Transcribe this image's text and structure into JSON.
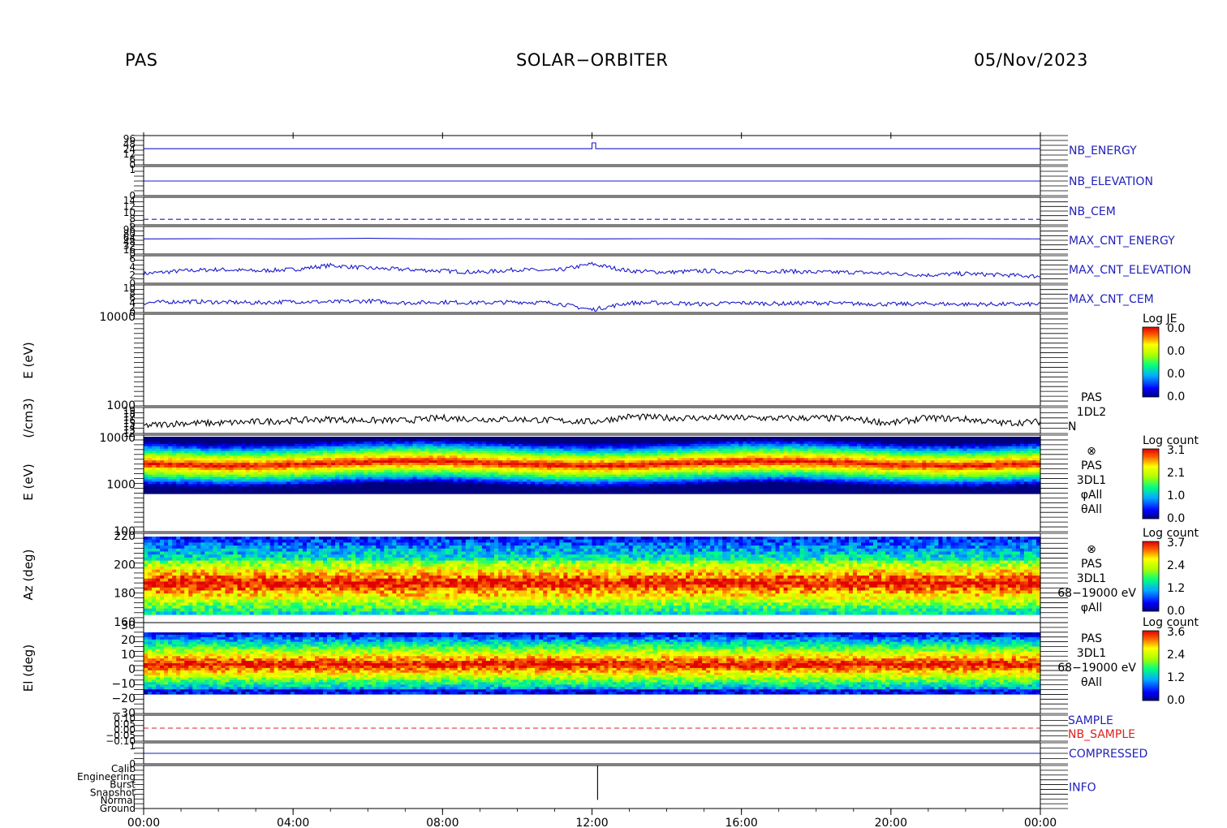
{
  "header": {
    "instrument": "PAS",
    "mission": "SOLAR−ORBITER",
    "date": "05/Nov/2023"
  },
  "colors": {
    "line_blue": "#1a1acc",
    "label_blue": "#2222bb",
    "label_red": "#dd2222",
    "black": "#000000"
  },
  "chart_data": [
    {
      "type": "line",
      "panel": "nb_energy",
      "title": "NB_ENERGY",
      "title_color": "#2222bb",
      "yticks": [
        "96",
        "48",
        "24",
        "12",
        "6",
        "0"
      ],
      "x_hours": [
        0,
        12,
        12,
        12.1,
        12.1,
        24
      ],
      "values": [
        0.55,
        0.55,
        0.75,
        0.75,
        0.55,
        0.55
      ],
      "ylim": [
        0,
        1
      ]
    },
    {
      "type": "line",
      "panel": "nb_elevation",
      "title": "NB_ELEVATION",
      "title_color": "#2222bb",
      "yticks": [
        "1",
        "",
        "",
        "",
        "",
        "0"
      ],
      "x_hours": [
        0,
        24
      ],
      "values": [
        0.5,
        0.5
      ],
      "ylim": [
        0,
        1
      ]
    },
    {
      "type": "line",
      "panel": "nb_cem",
      "title": "NB_CEM",
      "title_color": "#2222bb",
      "yticks": [
        "14",
        "12",
        "10",
        "8",
        "6"
      ],
      "x_hours": [
        0,
        24
      ],
      "values": [
        0.2,
        0.2
      ],
      "ylim": [
        0,
        1
      ],
      "dashed": true
    },
    {
      "type": "line",
      "panel": "max_cnt_energy",
      "title": "MAX_CNT_ENERGY",
      "title_color": "#2222bb",
      "yticks": [
        "96",
        "80",
        "64",
        "48",
        "32",
        "16",
        "0"
      ],
      "x_hours": [
        0,
        2,
        4,
        6,
        8,
        10,
        12,
        14,
        16,
        18,
        20,
        22,
        24
      ],
      "values": [
        0.55,
        0.56,
        0.55,
        0.57,
        0.55,
        0.56,
        0.55,
        0.56,
        0.55,
        0.56,
        0.55,
        0.56,
        0.55
      ],
      "ylim": [
        0,
        1
      ]
    },
    {
      "type": "line",
      "panel": "max_cnt_elevation",
      "title": "MAX_CNT_ELEVATION",
      "title_color": "#2222bb",
      "yticks": [
        "6",
        "4",
        "2",
        "0"
      ],
      "x_hours": [
        0,
        1,
        2,
        3,
        4,
        5,
        6,
        7,
        8,
        9,
        10,
        11,
        12,
        13,
        14,
        15,
        16,
        17,
        18,
        19,
        20,
        21,
        22,
        23,
        24
      ],
      "values": [
        0.35,
        0.45,
        0.5,
        0.45,
        0.5,
        0.65,
        0.55,
        0.5,
        0.45,
        0.4,
        0.5,
        0.45,
        0.7,
        0.45,
        0.4,
        0.45,
        0.4,
        0.45,
        0.4,
        0.4,
        0.35,
        0.3,
        0.35,
        0.3,
        0.25
      ],
      "ylim": [
        0,
        1
      ]
    },
    {
      "type": "line",
      "panel": "max_cnt_cem",
      "title": "MAX_CNT_CEM",
      "title_color": "#2222bb",
      "yticks": [
        "10",
        "8",
        "6",
        "4",
        "2",
        "0"
      ],
      "x_hours": [
        0,
        1,
        2,
        3,
        4,
        5,
        6,
        7,
        8,
        9,
        10,
        11,
        12,
        13,
        14,
        15,
        16,
        17,
        18,
        19,
        20,
        21,
        22,
        23,
        24
      ],
      "values": [
        0.35,
        0.4,
        0.38,
        0.35,
        0.4,
        0.38,
        0.42,
        0.35,
        0.38,
        0.35,
        0.38,
        0.35,
        0.1,
        0.35,
        0.35,
        0.3,
        0.35,
        0.32,
        0.35,
        0.32,
        0.3,
        0.32,
        0.3,
        0.3,
        0.3
      ],
      "ylim": [
        0,
        1
      ]
    },
    {
      "type": "heatmap",
      "panel": "pas_1dl2_energy",
      "ylabel": "E (eV)",
      "yscale": "log",
      "ylim": [
        300,
        20000
      ],
      "yticks": [
        "10000",
        "1000"
      ],
      "colorbar": {
        "title": "Log JE",
        "ticks": [
          "0.0",
          "0.0",
          "0.0",
          "0.0"
        ]
      },
      "empty": true
    },
    {
      "type": "line",
      "panel": "pas_1dl2_density",
      "ylabel": "(/cm3)",
      "labels": [
        "PAS",
        "1DL2",
        "N"
      ],
      "yticks": [
        "19",
        "18",
        "17",
        "16",
        "15",
        "14",
        "13",
        "12"
      ],
      "x_hours": [
        0,
        1,
        2,
        3,
        4,
        5,
        6,
        7,
        8,
        9,
        10,
        11,
        12,
        13,
        14,
        15,
        16,
        17,
        18,
        19,
        20,
        21,
        22,
        23,
        24
      ],
      "values": [
        0.3,
        0.4,
        0.4,
        0.45,
        0.5,
        0.55,
        0.5,
        0.5,
        0.6,
        0.55,
        0.55,
        0.5,
        0.45,
        0.65,
        0.6,
        0.6,
        0.6,
        0.58,
        0.6,
        0.55,
        0.4,
        0.6,
        0.55,
        0.4,
        0.45
      ],
      "ylim": [
        0,
        1
      ]
    },
    {
      "type": "heatmap",
      "panel": "pas_3dl1_energy",
      "ylabel": "E (eV)",
      "yscale": "log",
      "ylim": [
        60,
        15000
      ],
      "yticks": [
        "10000",
        "1000",
        "100"
      ],
      "labels": [
        "⊗",
        "PAS",
        "3DL1",
        "φAll",
        "θAll"
      ],
      "colorbar": {
        "title": "Log count",
        "ticks": [
          "3.1",
          "2.1",
          "1.0",
          "0.0"
        ]
      }
    },
    {
      "type": "heatmap",
      "panel": "pas_3dl1_azimuth",
      "ylabel": "Az (deg)",
      "ylim": [
        150,
        225
      ],
      "yticks": [
        "220",
        "200",
        "180",
        "160"
      ],
      "labels": [
        "⊗",
        "PAS",
        "3DL1",
        "68−19000 eV",
        "φAll"
      ],
      "colorbar": {
        "title": "Log count",
        "ticks": [
          "3.7",
          "2.4",
          "1.2",
          "0.0"
        ]
      }
    },
    {
      "type": "heatmap",
      "panel": "pas_3dl1_elevation",
      "ylabel": "El (deg)",
      "ylim": [
        -30,
        30
      ],
      "yticks": [
        "30",
        "20",
        "10",
        "0",
        "−10",
        "−20",
        "−30"
      ],
      "labels": [
        "PAS",
        "3DL1",
        "68−19000 eV",
        "θAll"
      ],
      "colorbar": {
        "title": "Log count",
        "ticks": [
          "3.6",
          "2.4",
          "1.2",
          "0.0"
        ]
      }
    },
    {
      "type": "line",
      "panel": "sample",
      "titles": [
        "SAMPLE",
        "NB_SAMPLE"
      ],
      "title_colors": [
        "#2222bb",
        "#dd2222"
      ],
      "yticks": [
        "0.10",
        "0.05",
        "0.00",
        "−0.05",
        "−0.10"
      ],
      "x_hours": [
        0,
        24
      ],
      "values": [
        0.5,
        0.5
      ],
      "ylim": [
        0,
        1
      ],
      "dashed": true
    },
    {
      "type": "line",
      "panel": "compressed",
      "title": "COMPRESSED",
      "title_color": "#2222bb",
      "yticks": [
        "1",
        "0"
      ],
      "x_hours": [
        0,
        24
      ],
      "values": [
        0.5,
        0.5
      ],
      "ylim": [
        0,
        1
      ]
    },
    {
      "type": "line",
      "panel": "info",
      "title": "INFO",
      "title_color": "#2222bb",
      "yticks": [
        "Calib",
        "Engineering",
        "Burst",
        "Snapshot",
        "Normal",
        "Ground"
      ],
      "x_hours": [
        12,
        12.15,
        12.15
      ],
      "values": [
        1,
        1,
        0.2
      ],
      "ylim": [
        0,
        1
      ]
    }
  ],
  "x_axis": {
    "ticks": [
      "00:00",
      "04:00",
      "08:00",
      "12:00",
      "16:00",
      "20:00",
      "00:00"
    ],
    "range_hours": [
      0,
      24
    ]
  }
}
